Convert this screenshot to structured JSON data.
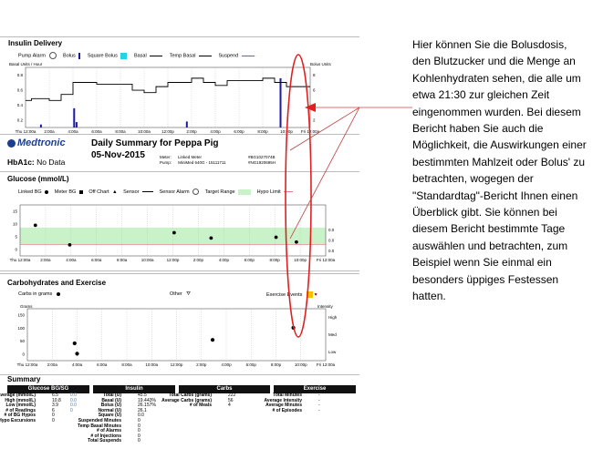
{
  "insulin_delivery": {
    "title": "Insulin Delivery",
    "legend": [
      "Pump Alarm",
      "Bolus",
      "Square Bolus",
      "Basal",
      "Temp Basal",
      "Suspend"
    ],
    "left_axis_label": "Basal Units / Hour",
    "right_axis_label": "Bolus Units",
    "y_ticks": [
      "0.8",
      "0.6",
      "0.4",
      "0.2"
    ],
    "right_ticks": [
      "8",
      "6",
      "4",
      "2"
    ],
    "x_ticks": [
      "Thu 12:00a",
      "2:00a",
      "4:00a",
      "6:00a",
      "8:00a",
      "10:00a",
      "12:00p",
      "2:00p",
      "4:00p",
      "6:00p",
      "8:00p",
      "10:00p",
      "Fri 12:00a"
    ],
    "colors": {
      "bolus": "#1a1aa8",
      "square_bolus": "#2ad0e8",
      "basal": "#000000",
      "temp_basal": "#000000",
      "suspend": "#2ca02c",
      "highlight": "#e02020"
    }
  },
  "report_header": {
    "logo": "Medtronic",
    "title": "Daily Summary for Peppa Pig",
    "date": "05-Nov-2015",
    "hba1c_label": "HbA1c:",
    "hba1c_value": "No Data",
    "meter_label": "Meter:",
    "meter_value": "Linked Meter",
    "meter_id": "#BG1027074B",
    "pump_label": "Pump:",
    "pump_value": "MiniMed 640G - 15111711",
    "pump_id": "#NG1920695H"
  },
  "glucose": {
    "title": "Glucose (mmol/L)",
    "legend": [
      "Linked BG",
      "Meter BG",
      "Off Chart",
      "Sensor",
      "Sensor Alarm",
      "Target Range",
      "Hypo Limit"
    ],
    "y_ticks": [
      "15",
      "10",
      "5",
      "0"
    ],
    "right_ticks": [
      "0.0",
      "0.0",
      "0.0"
    ],
    "x_ticks": [
      "Thu 12:00a",
      "2:00a",
      "4:00a",
      "6:00a",
      "8:00a",
      "10:00a",
      "12:00p",
      "2:00p",
      "4:00p",
      "6:00p",
      "8:00p",
      "10:00p",
      "Fri 12:00a"
    ],
    "target_range_color": "#c9f2c9",
    "hypo_color": "#e8788a"
  },
  "carbs_exercise": {
    "title": "Carbohydrates and Exercise",
    "legend_carbs": "Carbs in grams",
    "legend_other": "Other",
    "legend_exercise": "Exercise Events",
    "left_axis_label": "Grams",
    "right_axis_label": "Intensity",
    "y_ticks": [
      "150",
      "100",
      "50",
      "0"
    ],
    "right_ticks": [
      "High",
      "Med",
      "Low"
    ],
    "x_ticks": [
      "Thu 12:00a",
      "2:00a",
      "4:00a",
      "6:00a",
      "8:00a",
      "10:00a",
      "12:00p",
      "2:00p",
      "4:00p",
      "6:00p",
      "8:00p",
      "10:00p",
      "Fri 12:00a"
    ],
    "exercise_color": "#f2c200"
  },
  "summary": {
    "title": "Summary",
    "glucose": {
      "header": "Glucose BG/SG",
      "rows": [
        {
          "k": "Average (mmol/L)",
          "v": "6.5",
          "v2": "0.0"
        },
        {
          "k": "High (mmol/L)",
          "v": "10.8",
          "v2": "0.0"
        },
        {
          "k": "Low (mmol/L)",
          "v": "3.9",
          "v2": "0.0"
        },
        {
          "k": "# of Readings",
          "v": "6",
          "v2": "0"
        },
        {
          "k": "# of BG Hypos",
          "v": "0",
          "v2": ""
        },
        {
          "k": "# Hypo Excursions",
          "v": "0",
          "v2": ""
        }
      ]
    },
    "insulin": {
      "header": "Insulin",
      "rows": [
        {
          "k": "Total (U)",
          "v": "45.5",
          "v2": ""
        },
        {
          "k": "Basal (U)",
          "v": "19.4",
          "v2": "43%"
        },
        {
          "k": "Bolus (U)",
          "v": "26.1",
          "v2": "57%"
        },
        {
          "k": "Normal (U)",
          "v": "26.1",
          "v2": ""
        },
        {
          "k": "Square (U)",
          "v": "0.0",
          "v2": ""
        },
        {
          "k": "Suspended Minutes",
          "v": "0",
          "v2": ""
        },
        {
          "k": "Temp Basal Minutes",
          "v": "0",
          "v2": ""
        },
        {
          "k": "# of Alarms",
          "v": "0",
          "v2": ""
        },
        {
          "k": "# of Injections",
          "v": "0",
          "v2": ""
        },
        {
          "k": "Total Suspends",
          "v": "0",
          "v2": ""
        }
      ]
    },
    "carbs": {
      "header": "Carbs",
      "rows": [
        {
          "k": "Total Carbs (grams)",
          "v": "222",
          "v2": ""
        },
        {
          "k": "Average Carbs (grams)",
          "v": "56",
          "v2": ""
        },
        {
          "k": "# of Meals",
          "v": "4",
          "v2": ""
        }
      ]
    },
    "exercise": {
      "header": "Exercise",
      "rows": [
        {
          "k": "Total Minutes",
          "v": "-",
          "v2": ""
        },
        {
          "k": "Average Intensity",
          "v": "-",
          "v2": ""
        },
        {
          "k": "Average Minutes",
          "v": "-",
          "v2": ""
        },
        {
          "k": "# of Episodes",
          "v": "-",
          "v2": ""
        }
      ]
    }
  },
  "annotation_text": "Hier können Sie die Bolusdosis, den Blutzucker und die Menge an Kohlenhydraten sehen, die alle um etwa 21:30 zur gleichen Zeit eingenommen wurden. Bei diesem Bericht haben Sie auch die Möglichkeit, die Auswirkungen einer bestimmten Mahlzeit oder Bolus' zu betrachten, wogegen der \"Standardtag\"-Bericht Ihnen einen Überblick gibt. Sie können bei diesem Bericht bestimmte Tage auswählen und betrachten, zum Beispiel wenn Sie einmal ein besonders üppiges Festessen hatten.",
  "chart_data": [
    {
      "type": "bar",
      "name_ref": "insulin-delivery",
      "series": [
        {
          "name": "Bolus",
          "x_hours": [
            1.3,
            4.1,
            4.3,
            13.6,
            21.5
          ],
          "values": [
            0.5,
            3.2,
            0.9,
            1.0,
            8.2
          ]
        }
      ],
      "basal_steps": [
        [
          0,
          0.45
        ],
        [
          0.5,
          0.48
        ],
        [
          2,
          0.45
        ],
        [
          3,
          0.55
        ],
        [
          4,
          0.75
        ],
        [
          6,
          0.72
        ],
        [
          9,
          0.62
        ],
        [
          10,
          0.58
        ],
        [
          11,
          0.68
        ],
        [
          12,
          0.75
        ],
        [
          14,
          0.82
        ],
        [
          15,
          0.75
        ],
        [
          16,
          0.7
        ],
        [
          17,
          0.78
        ],
        [
          20,
          0.82
        ],
        [
          21,
          0.75
        ],
        [
          22,
          0.68
        ],
        [
          24,
          0.68
        ]
      ],
      "xlim": [
        0,
        24
      ],
      "ylim": [
        0,
        1.0
      ],
      "bolus_ylim": [
        0,
        10
      ]
    },
    {
      "type": "scatter",
      "name_ref": "glucose",
      "series": [
        {
          "name": "Linked BG",
          "x_hours": [
            1.2,
            3.9,
            12.1,
            15.0,
            20.1,
            21.7
          ],
          "values": [
            10.8,
            3.9,
            8.2,
            6.3,
            6.6,
            4.9
          ]
        }
      ],
      "target_range": [
        4.0,
        10.0
      ],
      "xlim": [
        0,
        24
      ],
      "ylim": [
        0,
        18
      ]
    },
    {
      "type": "scatter",
      "name_ref": "carbs",
      "series": [
        {
          "name": "Carbs in grams",
          "x_hours": [
            3.8,
            4.0,
            14.9,
            21.4
          ],
          "values": [
            50,
            20,
            60,
            95
          ]
        }
      ],
      "xlim": [
        0,
        24
      ],
      "ylim": [
        0,
        150
      ]
    }
  ]
}
